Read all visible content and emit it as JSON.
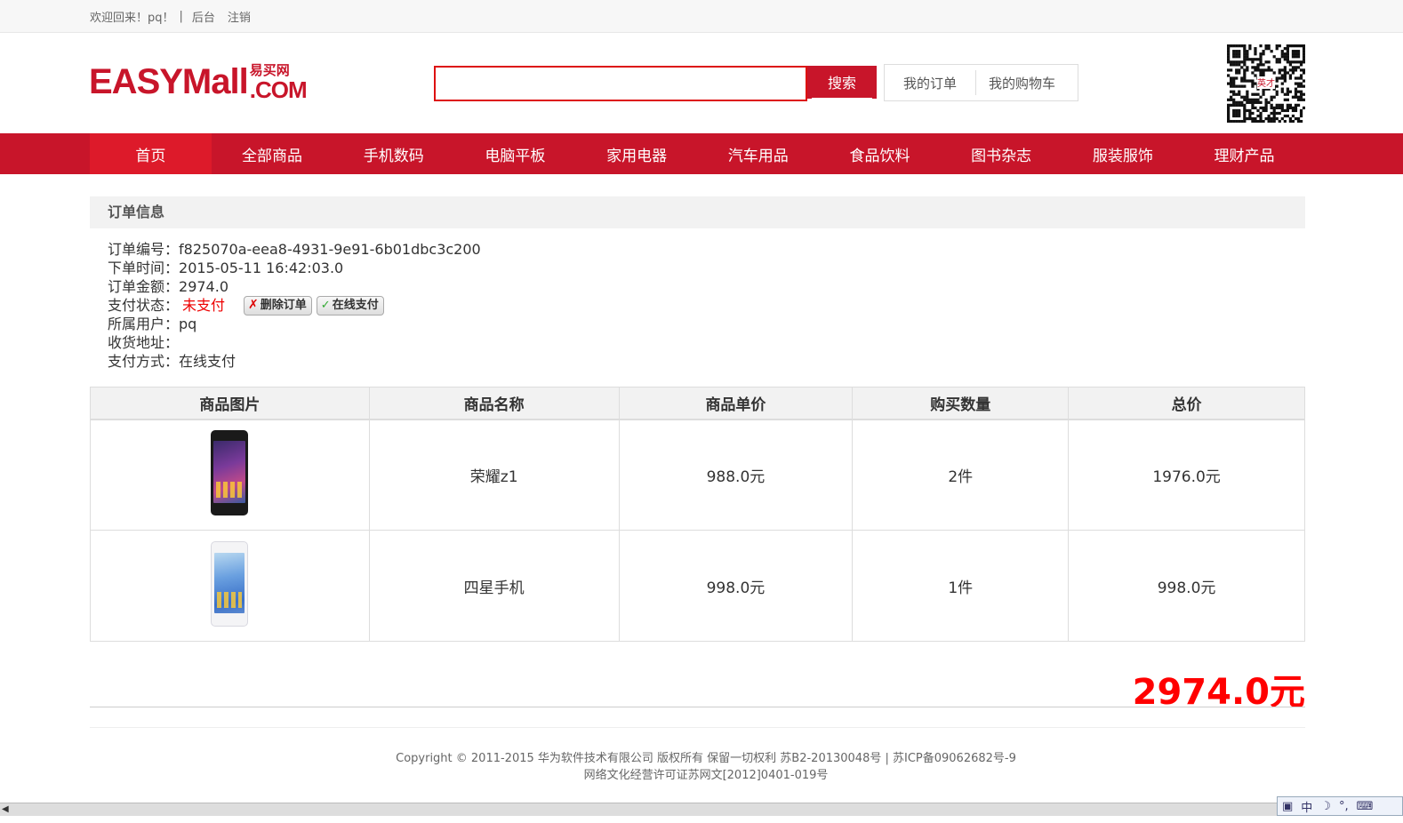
{
  "topbar": {
    "welcome": "欢迎回来！pq！",
    "separator": "|",
    "admin_link": "后台",
    "logout_link": "注销"
  },
  "logo": {
    "main": "EASYMall",
    "cn": "易买网",
    "dotcom": ".COM"
  },
  "search": {
    "value": "",
    "placeholder": "",
    "button_label": "搜索"
  },
  "quick_links": {
    "my_orders": "我的订单",
    "my_cart": "我的购物车"
  },
  "qr": {
    "center_label": "英才"
  },
  "nav": {
    "items": [
      {
        "label": "首页",
        "active": true
      },
      {
        "label": "全部商品"
      },
      {
        "label": "手机数码"
      },
      {
        "label": "电脑平板"
      },
      {
        "label": "家用电器"
      },
      {
        "label": "汽车用品"
      },
      {
        "label": "食品饮料"
      },
      {
        "label": "图书杂志"
      },
      {
        "label": "服装服饰"
      },
      {
        "label": "理财产品"
      }
    ]
  },
  "order": {
    "section_title": "订单信息",
    "id_label": "订单编号：",
    "id": "f825070a-eea8-4931-9e91-6b01dbc3c200",
    "time_label": "下单时间：",
    "time": "2015-05-11 16:42:03.0",
    "amount_label": "订单金额：",
    "amount": "2974.0",
    "status_label": "支付状态：",
    "status": "未支付",
    "delete_button": "删除订单",
    "pay_button": "在线支付",
    "user_label": "所属用户：",
    "user": "pq",
    "address_label": "收货地址：",
    "address": "",
    "pay_method_label": "支付方式：",
    "pay_method": "在线支付"
  },
  "table": {
    "headers": [
      "商品图片",
      "商品名称",
      "商品单价",
      "购买数量",
      "总价"
    ],
    "rows": [
      {
        "name": "荣耀z1",
        "price": "988.0元",
        "qty": "2件",
        "total": "1976.0元",
        "image": "black-phone"
      },
      {
        "name": "四星手机",
        "price": "998.0元",
        "qty": "1件",
        "total": "998.0元",
        "image": "white-phone"
      }
    ]
  },
  "grand_total": "2974.0元",
  "footer": {
    "line1": "Copyright © 2011-2015 华为软件技术有限公司 版权所有 保留一切权利 苏B2-20130048号 | 苏ICP备09062682号-9",
    "line2": "网络文化经营许可证苏网文[2012]0401-019号"
  },
  "ime": {
    "mode": "中"
  },
  "colors": {
    "brand_red": "#c8152a",
    "price_red": "#ff0000"
  }
}
